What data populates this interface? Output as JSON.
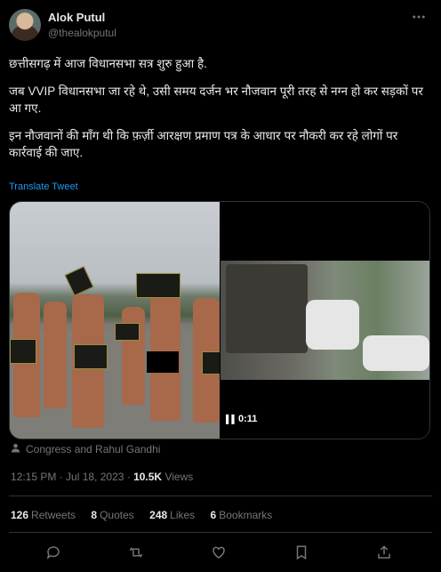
{
  "author": {
    "name": "Alok Putul",
    "handle": "@thealokputul"
  },
  "tweet": {
    "paragraphs": [
      "छत्तीसगढ़ में आज विधानसभा सत्र शुरु हुआ है.",
      "जब VVIP विधानसभा जा रहे थे, उसी समय दर्जन भर नौजवान पूरी तरह से नग्न हो कर सड़कों पर आ गए.",
      "इन नौजवानों की माँग थी कि फ़र्ज़ी आरक्षण प्रमाण पत्र के आधार पर नौकरी कर रहे लोगों पर कार्रवाई की जाए."
    ],
    "translate_label": "Translate Tweet"
  },
  "media": {
    "duration": "0:11"
  },
  "attribution": "Congress and Rahul Gandhi",
  "meta": {
    "time": "12:15 PM · Jul 18, 2023 · ",
    "views_count": "10.5K",
    "views_label": " Views"
  },
  "stats": {
    "retweets": {
      "count": "126",
      "label": "Retweets"
    },
    "quotes": {
      "count": "8",
      "label": "Quotes"
    },
    "likes": {
      "count": "248",
      "label": "Likes"
    },
    "bookmarks": {
      "count": "6",
      "label": "Bookmarks"
    }
  },
  "icons": [
    "more-icon",
    "pause-icon",
    "person-icon",
    "reply-icon",
    "retweet-icon",
    "like-icon",
    "bookmark-icon",
    "share-icon"
  ]
}
